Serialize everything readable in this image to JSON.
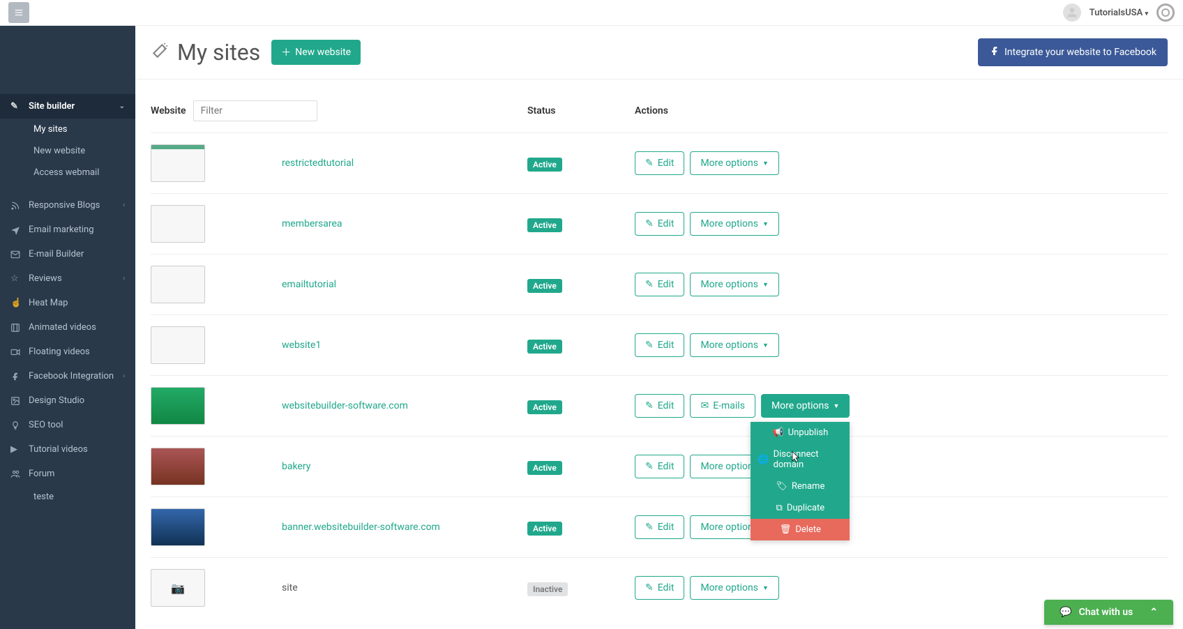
{
  "header": {
    "user": "TutorialsUSA"
  },
  "page": {
    "title": "My sites",
    "new_btn": "New website",
    "fb_btn": "Integrate your website to Facebook"
  },
  "sidebar": {
    "site_builder": "Site builder",
    "my_sites": "My sites",
    "new_website": "New website",
    "access_webmail": "Access webmail",
    "responsive_blogs": "Responsive Blogs",
    "email_marketing": "Email marketing",
    "email_builder": "E-mail Builder",
    "reviews": "Reviews",
    "heat_map": "Heat Map",
    "animated_videos": "Animated videos",
    "floating_videos": "Floating videos",
    "fb_integration": "Facebook Integration",
    "design_studio": "Design Studio",
    "seo_tool": "SEO tool",
    "tutorial_videos": "Tutorial videos",
    "forum": "Forum",
    "teste": "teste"
  },
  "table": {
    "col_website": "Website",
    "col_status": "Status",
    "col_actions": "Actions",
    "filter_placeholder": "Filter",
    "edit": "Edit",
    "more_options": "More options",
    "emails": "E-mails",
    "status_active": "Active",
    "status_inactive": "Inactive"
  },
  "sites": {
    "s0": "restrictedtutorial",
    "s1": "membersarea",
    "s2": "emailtutorial",
    "s3": "website1",
    "s4": "websitebuilder-software.com",
    "s5": "bakery",
    "s6": "banner.websitebuilder-software.com",
    "s7": "site"
  },
  "dropdown": {
    "unpublish": "Unpublish",
    "disconnect": "Disconnect domain",
    "rename": "Rename",
    "duplicate": "Duplicate",
    "delete": "Delete"
  },
  "chat": {
    "label": "Chat with us"
  }
}
